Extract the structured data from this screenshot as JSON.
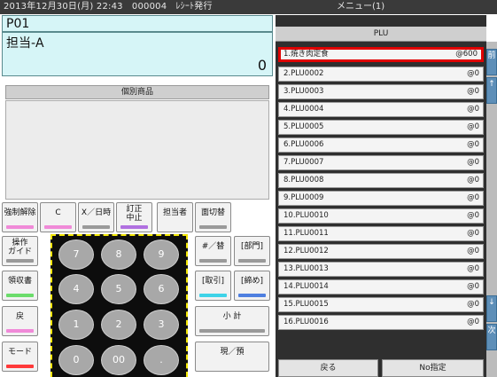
{
  "status_bar": {
    "text": "2013年12月30日(月) 22:43　000004　ﾚｼｰﾄ発行",
    "menu_title": "メニュー(1)"
  },
  "register": {
    "id": "P01",
    "staff": "担当-A",
    "amount": "0",
    "department": "個別商品"
  },
  "keys": {
    "force_release": "強制解除",
    "clear": "C",
    "mult_time": "X／日時",
    "void_cancel": "訂正\n中止",
    "staff_key": "担当者",
    "screen_switch": "面切替",
    "op_guide": "操作\nガイド",
    "hash_change": "#／替",
    "dept": "[部門]",
    "receipt": "領収書",
    "transaction": "[取引]",
    "closing": "[締め]",
    "return": "戻",
    "subtotal": "小 計",
    "mode": "モード",
    "cash_deposit": "現／預"
  },
  "numpad": [
    "7",
    "8",
    "9",
    "4",
    "5",
    "6",
    "1",
    "2",
    "3",
    "0",
    "00",
    "."
  ],
  "stripe_colors": {
    "pink": "#f08ad8",
    "purple": "#b070e0",
    "gray": "#9a9a9a",
    "cyan": "#3fd3e8",
    "green": "#6bdc6b",
    "blue": "#4e7fe0",
    "red": "#ff3a3a"
  },
  "plu": {
    "header": "PLU",
    "selected_color": "#e00000",
    "items": [
      {
        "name": "1.焼き肉定食",
        "price": "@600"
      },
      {
        "name": "2.PLU0002",
        "price": "@0"
      },
      {
        "name": "3.PLU0003",
        "price": "@0"
      },
      {
        "name": "4.PLU0004",
        "price": "@0"
      },
      {
        "name": "5.PLU0005",
        "price": "@0"
      },
      {
        "name": "6.PLU0006",
        "price": "@0"
      },
      {
        "name": "7.PLU0007",
        "price": "@0"
      },
      {
        "name": "8.PLU0008",
        "price": "@0"
      },
      {
        "name": "9.PLU0009",
        "price": "@0"
      },
      {
        "name": "10.PLU0010",
        "price": "@0"
      },
      {
        "name": "11.PLU0011",
        "price": "@0"
      },
      {
        "name": "12.PLU0012",
        "price": "@0"
      },
      {
        "name": "13.PLU0013",
        "price": "@0"
      },
      {
        "name": "14.PLU0014",
        "price": "@0"
      },
      {
        "name": "15.PLU0015",
        "price": "@0"
      },
      {
        "name": "16.PLU0016",
        "price": "@0"
      }
    ],
    "back_label": "戻る",
    "no_label": "No指定"
  },
  "side_tabs": {
    "prev": "前",
    "up": "↑",
    "down": "↓",
    "next": "次"
  }
}
